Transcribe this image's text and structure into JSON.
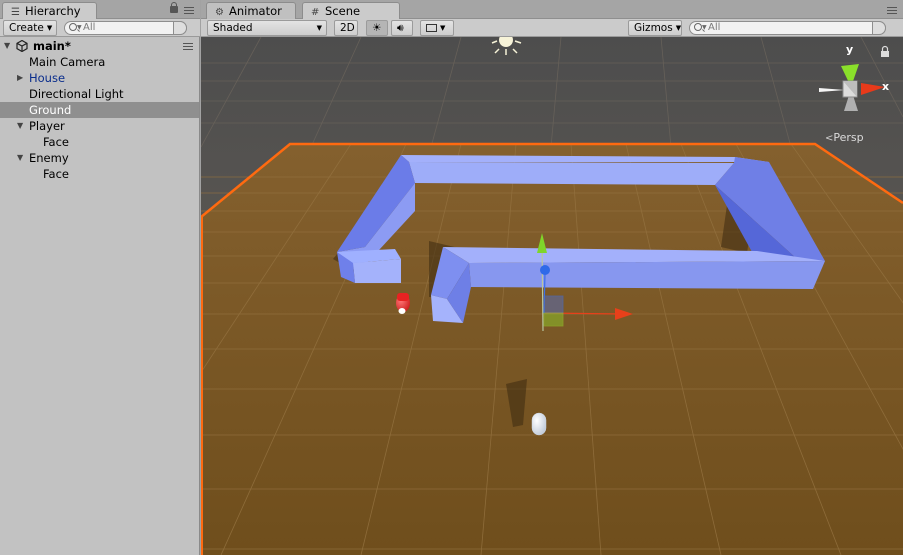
{
  "hierarchy": {
    "tab_label": "Hierarchy",
    "create_label": "Create",
    "search_placeholder": "All",
    "scene_name": "main*",
    "items": [
      {
        "label": "Main Camera"
      },
      {
        "label": "House"
      },
      {
        "label": "Directional Light"
      },
      {
        "label": "Ground"
      },
      {
        "label": "Player"
      },
      {
        "label": "Face"
      },
      {
        "label": "Enemy"
      },
      {
        "label": "Face"
      }
    ]
  },
  "scene_view": {
    "tabs": [
      {
        "label": "Animator"
      },
      {
        "label": "Scene"
      }
    ],
    "shading_mode": "Shaded",
    "mode_2d_label": "2D",
    "gizmos_label": "Gizmos",
    "search_placeholder": "All",
    "projection_label": "Persp",
    "axes": {
      "y": "y",
      "x": "x"
    }
  },
  "colors": {
    "selection_outline": "#ff6a10",
    "ground": "#7a5522",
    "walls": "#7f8ff0",
    "axis_y": "#7fd62a",
    "axis_x": "#e8401a",
    "axis_z": "#3b6fe6",
    "enemy": "#ee3333"
  },
  "icons": [
    "hierarchy-icon",
    "animator-icon",
    "scene-grid-icon",
    "lock-icon",
    "menu-icon",
    "unity-scene-icon",
    "sun-light-icon",
    "audio-icon",
    "image-effects-icon",
    "search-icon"
  ]
}
